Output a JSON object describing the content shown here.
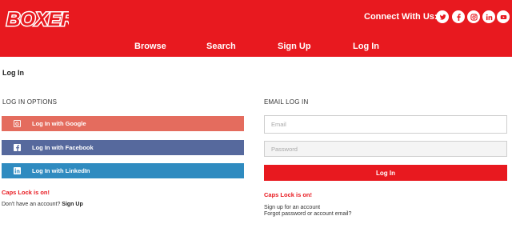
{
  "header": {
    "logo_text": "BOXER",
    "connect_label": "Connect With Us:",
    "social_icons": [
      "twitter-icon",
      "facebook-icon",
      "instagram-icon",
      "linkedin-icon",
      "youtube-icon"
    ],
    "brand_color": "#e8191f"
  },
  "nav": {
    "items": [
      {
        "label": "Browse"
      },
      {
        "label": "Search"
      },
      {
        "label": "Sign Up"
      },
      {
        "label": "Log In"
      }
    ]
  },
  "page": {
    "title": "Log In"
  },
  "left": {
    "section_label": "LOG IN OPTIONS",
    "buttons": [
      {
        "label": "Log In with Google",
        "icon": "google-icon",
        "color": "#e46c5e"
      },
      {
        "label": "Log In with Facebook",
        "icon": "facebook-icon",
        "color": "#56699d"
      },
      {
        "label": "Log In with LinkedIn",
        "icon": "linkedin-icon",
        "color": "#2f8bc0"
      }
    ],
    "caps_warning": "Caps Lock is on!",
    "signup_prompt": "Don't have an account?",
    "signup_link": "Sign Up"
  },
  "right": {
    "section_label": "EMAIL LOG IN",
    "email_placeholder": "Email",
    "password_placeholder": "Password",
    "login_button": "Log In",
    "caps_warning": "Caps Lock is on!",
    "signup_link": "Sign up for an account",
    "forgot_link": "Forgot password or account email?"
  }
}
